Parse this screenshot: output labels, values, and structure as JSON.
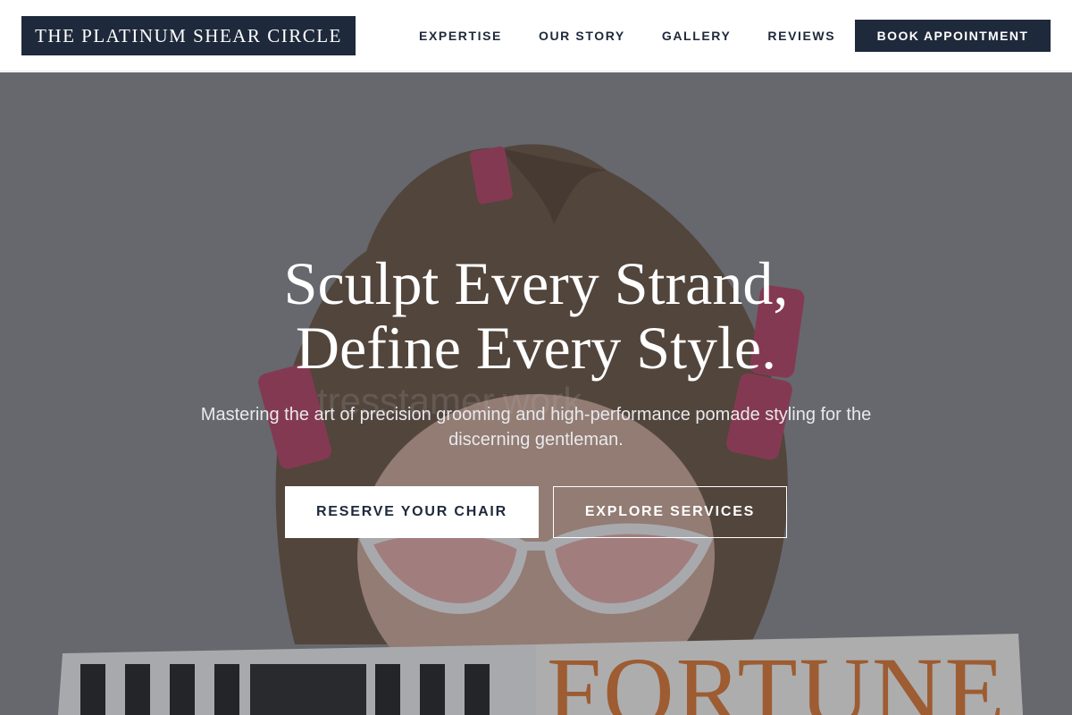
{
  "brand": {
    "name": "THE PLATINUM SHEAR CIRCLE"
  },
  "nav": {
    "items": [
      {
        "label": "EXPERTISE"
      },
      {
        "label": "OUR STORY"
      },
      {
        "label": "GALLERY"
      },
      {
        "label": "REVIEWS"
      }
    ],
    "cta_label": "BOOK APPOINTMENT"
  },
  "hero": {
    "title_line1": "Sculpt Every Strand,",
    "title_line2": "Define Every Style.",
    "subtitle": "Mastering the art of precision grooming and high-performance pomade styling for the discerning gentleman.",
    "primary_button": "RESERVE YOUR CHAIR",
    "secondary_button": "EXPLORE SERVICES",
    "image": {
      "description_icon": "hero-photo",
      "magazine_text": "FORTUNE",
      "watermark_text": "tresstamer.work"
    }
  },
  "colors": {
    "brand_dark": "#1e293b",
    "hero_overlay": "#14161e",
    "accent_orange": "#d97a3a"
  }
}
